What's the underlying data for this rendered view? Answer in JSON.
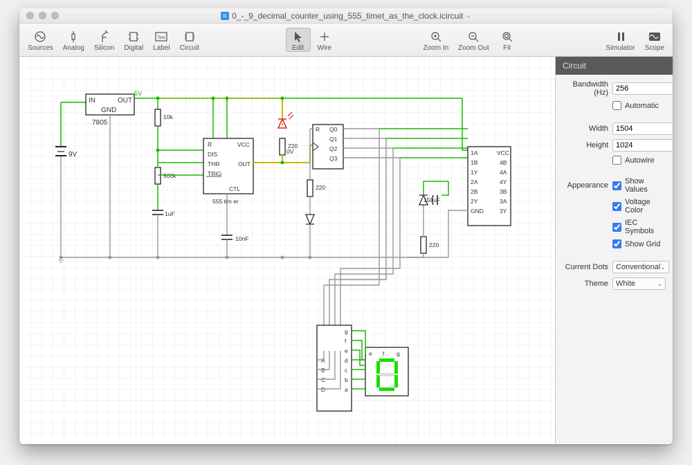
{
  "title": "0_-_9_decimal_counter_using_555_timet_as_the_clock.icircuit",
  "toolbar": {
    "sources": "Sources",
    "analog": "Analog",
    "silicon": "Silicon",
    "digital": "Digital",
    "label": "Label",
    "circuit": "Circuit",
    "edit": "Edit",
    "wire": "Wire",
    "zoom_in": "Zoom In",
    "zoom_out": "Zoom Out",
    "fit": "Fit",
    "simulator": "Simulator",
    "scope": "Scope"
  },
  "canvas": {
    "labels": {
      "v5": "5V",
      "v9": "9V",
      "v0": "0V",
      "reg_in": "IN",
      "reg_out": "OUT",
      "reg_gnd": "GND",
      "reg_part": "7805",
      "r10k": "10k",
      "r500k": "500k",
      "r220a": "220",
      "r220b": "220",
      "r220c": "220",
      "c_1uF": "1uF",
      "c_10nF": "10nF",
      "c_150uF": "150uF",
      "timer_name": "555 tim er",
      "timer_R": "R̄",
      "timer_VCC": "VCC",
      "timer_DIS": "DIS",
      "timer_THR": "THR",
      "timer_TRIG": "TRIG",
      "timer_OUT": "OUT",
      "timer_CTL": "CTL",
      "ff_R": "R",
      "ff_Q0": "Q0",
      "ff_Q1": "Q1",
      "ff_Q2": "Q2",
      "ff_Q3": "Q3",
      "mux_1A": "1A",
      "mux_1B": "1B",
      "mux_1Y": "1Y",
      "mux_2A": "2A",
      "mux_2B": "2B",
      "mux_2Y": "2Y",
      "mux_GND": "GND",
      "mux_VCC": "VCC",
      "mux_4B": "4B",
      "mux_4A": "4A",
      "mux_3B": "3B",
      "mux_3A": "3A",
      "mux_3Y": "3Y",
      "dec_A": "A",
      "dec_B": "B",
      "dec_C": "C",
      "dec_D": "D",
      "dec_a": "a",
      "dec_b": "b",
      "dec_c": "c",
      "dec_d": "d",
      "dec_e": "e",
      "dec_f": "f",
      "dec_g": "g",
      "disp_e": "e",
      "disp_f": "f",
      "disp_g": "g"
    }
  },
  "sidebar": {
    "header": "Circuit",
    "bandwidth_label": "Bandwidth (Hz)",
    "bandwidth_value": "256",
    "automatic": "Automatic",
    "width_label": "Width",
    "width_value": "1504",
    "height_label": "Height",
    "height_value": "1024",
    "autowire": "Autowire",
    "appearance_label": "Appearance",
    "show_values": "Show Values",
    "voltage_color": "Voltage Color",
    "iec_symbols": "IEC Symbols",
    "show_grid": "Show Grid",
    "current_dots_label": "Current Dots",
    "current_dots_value": "Conventional",
    "theme_label": "Theme",
    "theme_value": "White"
  }
}
